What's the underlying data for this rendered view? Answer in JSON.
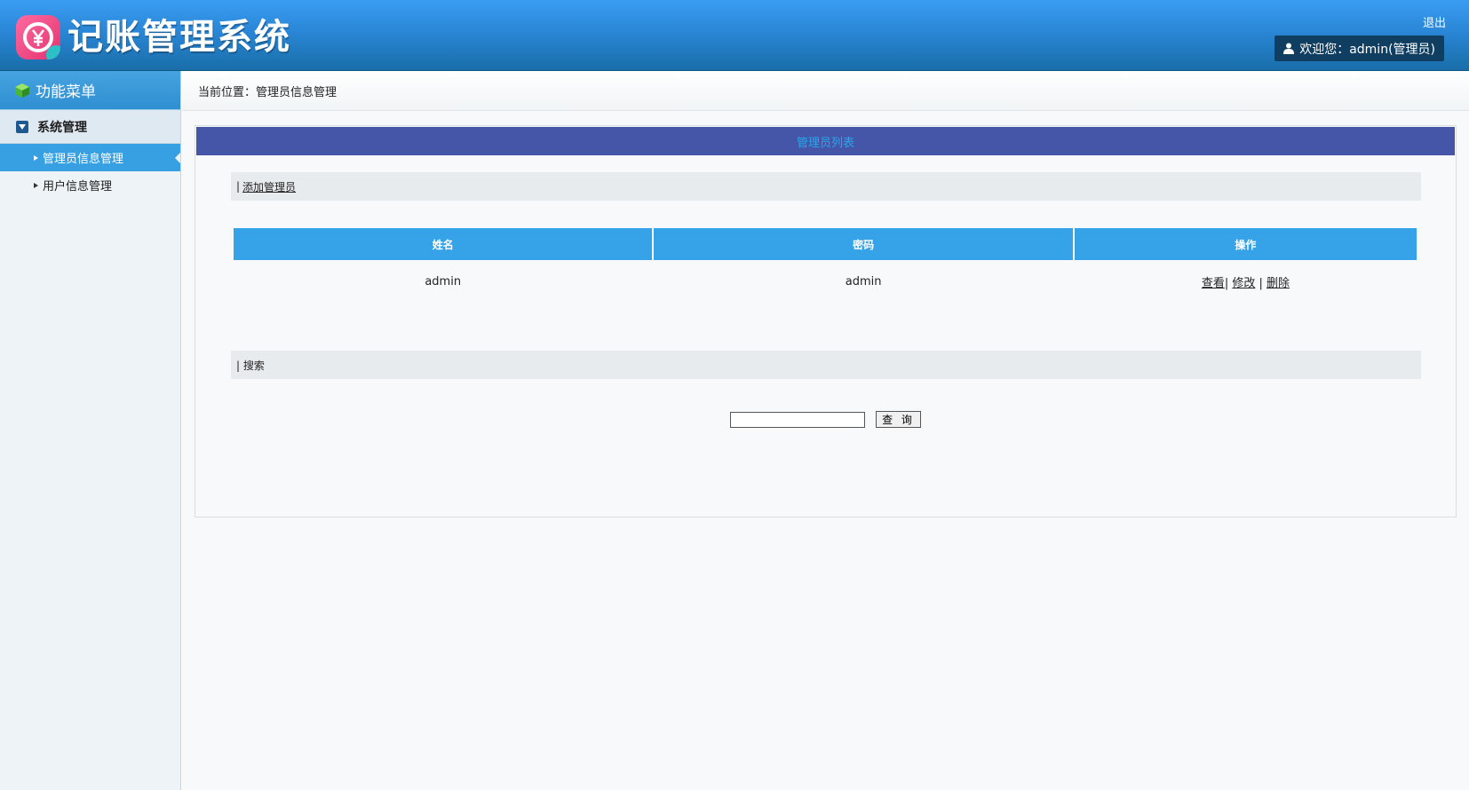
{
  "header": {
    "app_title": "记账管理系统",
    "logout": "退出",
    "welcome": "欢迎您：admin(管理员)",
    "logo_icon": "yen-icon"
  },
  "sidebar": {
    "title": "功能菜单",
    "group": "系统管理",
    "items": [
      {
        "label": "管理员信息管理",
        "active": true
      },
      {
        "label": "用户信息管理",
        "active": false
      }
    ]
  },
  "breadcrumb": "当前位置：管理员信息管理",
  "panel": {
    "title": "管理员列表",
    "add_prefix": "|",
    "add_link": "添加管理员",
    "search_label": "| 搜索",
    "search_button": "查 询",
    "search_value": ""
  },
  "table": {
    "columns": [
      "姓名",
      "密码",
      "操作"
    ],
    "rows": [
      {
        "name": "admin",
        "password": "admin",
        "view": "查看",
        "edit": "修改",
        "delete": "删除"
      }
    ]
  },
  "colors": {
    "header": "#2a86d6",
    "panel_title_bg": "#4556a8",
    "table_header": "#36a3e8",
    "active_menu": "#36a0e3"
  }
}
